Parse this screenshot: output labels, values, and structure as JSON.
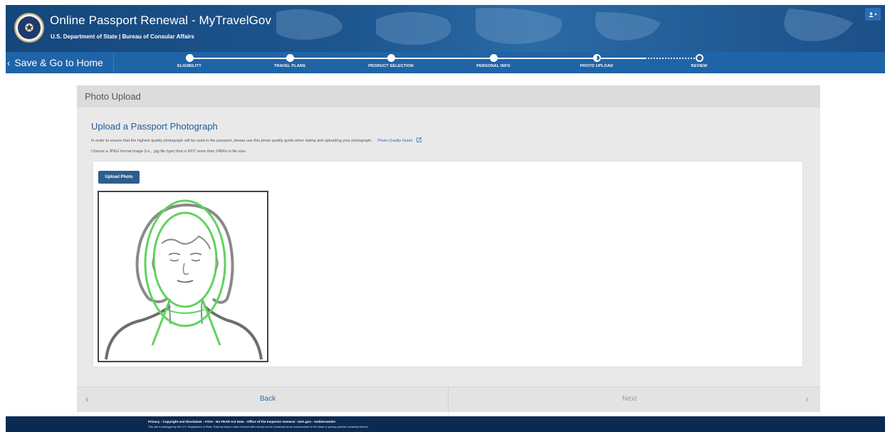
{
  "header": {
    "title": "Online Passport Renewal - MyTravelGov",
    "subtitle": "U.S. Department of State | Bureau of Consular Affairs",
    "user_icon": "user-icon",
    "user_menu": "▾"
  },
  "progress": {
    "back_label": "Save & Go to Home",
    "steps": [
      {
        "label": "ELIGIBILITY",
        "state": "complete"
      },
      {
        "label": "TRAVEL PLANS",
        "state": "complete"
      },
      {
        "label": "PRODUCT SELECTION",
        "state": "complete"
      },
      {
        "label": "PERSONAL INFO",
        "state": "complete"
      },
      {
        "label": "PHOTO UPLOAD",
        "state": "current"
      },
      {
        "label": "REVIEW",
        "state": "upcoming"
      }
    ]
  },
  "panel": {
    "title": "Photo Upload",
    "upload_heading": "Upload a Passport Photograph",
    "instruction": "In order to ensure that the highest quality photograph will be used in the passport, please use this photo quality guide when taking and uploading your photograph.",
    "guide_link": "Photo Quality Guide",
    "file_note": "Choose a JPEG format image (i.e., .jpg file type) that is NOT more than 240Kb in file size.",
    "upload_button": "Upload Photo"
  },
  "nav": {
    "back": "Back",
    "next": "Next"
  },
  "footer": {
    "links": "Privacy - Copyright and Disclaimer - FOIA - No FEAR Act Data - Office of the Inspector General - USA.gov - GobiernoUSA",
    "note": "This site is managed by the U.S. Department of State. External links to other Internet sites should not be construed as an endorsement of the views or privacy policies contained therein."
  },
  "colors": {
    "header_blue": "#1e5690",
    "progress_blue": "#2064a8",
    "link_blue": "#2e6db3",
    "button_blue": "#2c5d8f",
    "footer_navy": "#0b2a52",
    "guide_green": "#5fd35f"
  }
}
